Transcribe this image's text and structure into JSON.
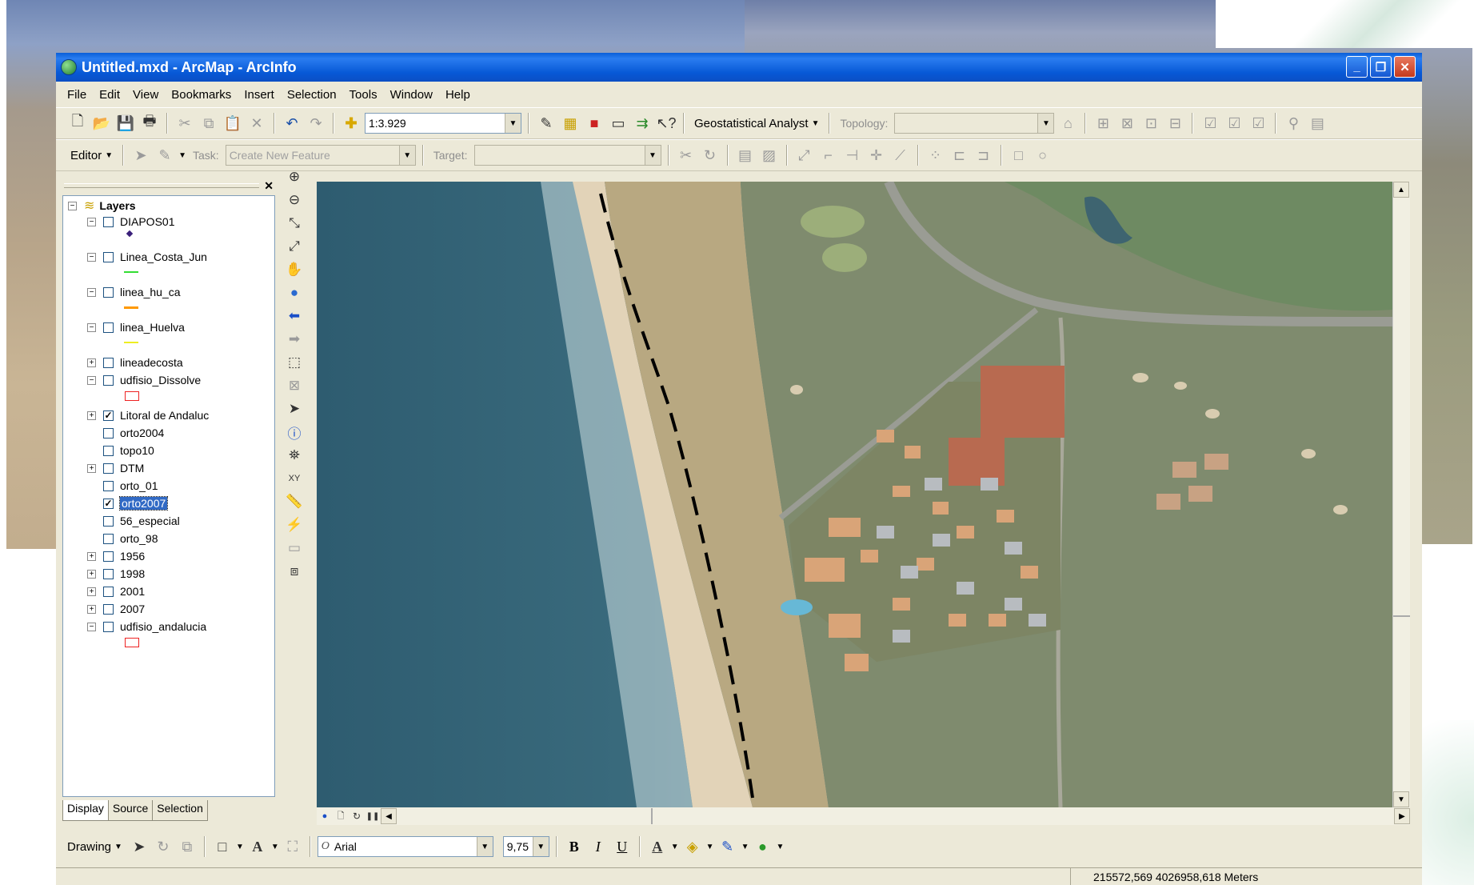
{
  "window": {
    "title": "Untitled.mxd - ArcMap - ArcInfo",
    "minimize": "_",
    "restore": "❐",
    "close": "✕"
  },
  "menu": [
    "File",
    "Edit",
    "View",
    "Bookmarks",
    "Insert",
    "Selection",
    "Tools",
    "Window",
    "Help"
  ],
  "standard_toolbar": {
    "scale": "1:3.929",
    "geostatistical_label": "Geostatistical Analyst",
    "topology_label": "Topology:"
  },
  "editor_toolbar": {
    "editor_label": "Editor",
    "task_label": "Task:",
    "task_value": "Create New Feature",
    "target_label": "Target:"
  },
  "toc": {
    "root": "Layers",
    "layers": [
      {
        "name": "DIAPOS01",
        "exp": "−",
        "checked": false
      },
      {
        "name": "Linea_Costa_Jun",
        "exp": "−",
        "checked": false
      },
      {
        "name": "linea_hu_ca",
        "exp": "−",
        "checked": false
      },
      {
        "name": "linea_Huelva",
        "exp": "−",
        "checked": false
      },
      {
        "name": "lineadecosta",
        "exp": "+",
        "checked": false
      },
      {
        "name": "udfisio_Dissolve",
        "exp": "−",
        "checked": false
      },
      {
        "name": "Litoral de Andaluc",
        "exp": "+",
        "checked": true
      },
      {
        "name": "orto2004",
        "exp": "",
        "checked": false
      },
      {
        "name": "topo10",
        "exp": "",
        "checked": false
      },
      {
        "name": "DTM",
        "exp": "+",
        "checked": false
      },
      {
        "name": "orto_01",
        "exp": "",
        "checked": false
      },
      {
        "name": "orto2007",
        "exp": "",
        "checked": true,
        "selected": true
      },
      {
        "name": "56_especial",
        "exp": "",
        "checked": false
      },
      {
        "name": "orto_98",
        "exp": "",
        "checked": false
      },
      {
        "name": "1956",
        "exp": "+",
        "checked": false
      },
      {
        "name": "1998",
        "exp": "+",
        "checked": false
      },
      {
        "name": "2001",
        "exp": "+",
        "checked": false
      },
      {
        "name": "2007",
        "exp": "+",
        "checked": false
      },
      {
        "name": "udfisio_andalucia",
        "exp": "−",
        "checked": false
      }
    ],
    "tabs": [
      "Display",
      "Source",
      "Selection"
    ]
  },
  "drawing_toolbar": {
    "drawing_label": "Drawing",
    "font": "Arial",
    "size": "9,75",
    "bold": "B",
    "italic": "I",
    "underline": "U",
    "text_tool": "A"
  },
  "status": {
    "coordinates": "215572,569  4026958,618 Meters"
  },
  "colors": {
    "titlebar": "#0758d6",
    "selection": "#316ac5",
    "symbol_green": "#33dd33",
    "symbol_orange": "#ff9900",
    "symbol_yellow": "#eeee22",
    "symbol_red": "#ee2222",
    "symbol_purple": "#3a1f7a"
  }
}
